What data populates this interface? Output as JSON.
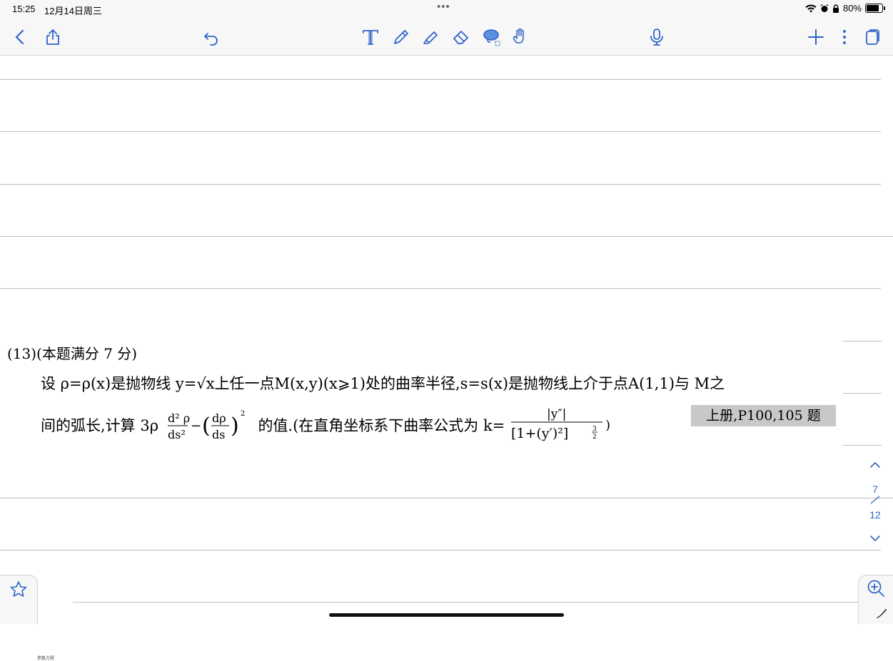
{
  "status_bar": {
    "time": "15:25",
    "date": "12月14日周三",
    "battery": "80%",
    "battery_level": 0.8
  },
  "problem": {
    "heading": "(13)(本题满分 7 分)",
    "line1": "设 ρ=ρ(x)是抛物线 y=√x上任一点M(x,y)(x⩾1)处的曲率半径,s=s(x)是抛物线上介于点A(1,1)与 M之",
    "line2_a": "间的弧长,计算 3ρ",
    "line2_b": "的值.(在直角坐标系下曲率公式为 k=",
    "badge": "上册,P100,105 题"
  },
  "page_nav": {
    "current": "7",
    "total": "12"
  },
  "footer_text": "参数方程",
  "colors": {
    "accent": "#2f64c8",
    "rule": "#b5bfca",
    "toolbar_bg": "#f7f7f8",
    "badge_bg": "#c8c8c8"
  }
}
